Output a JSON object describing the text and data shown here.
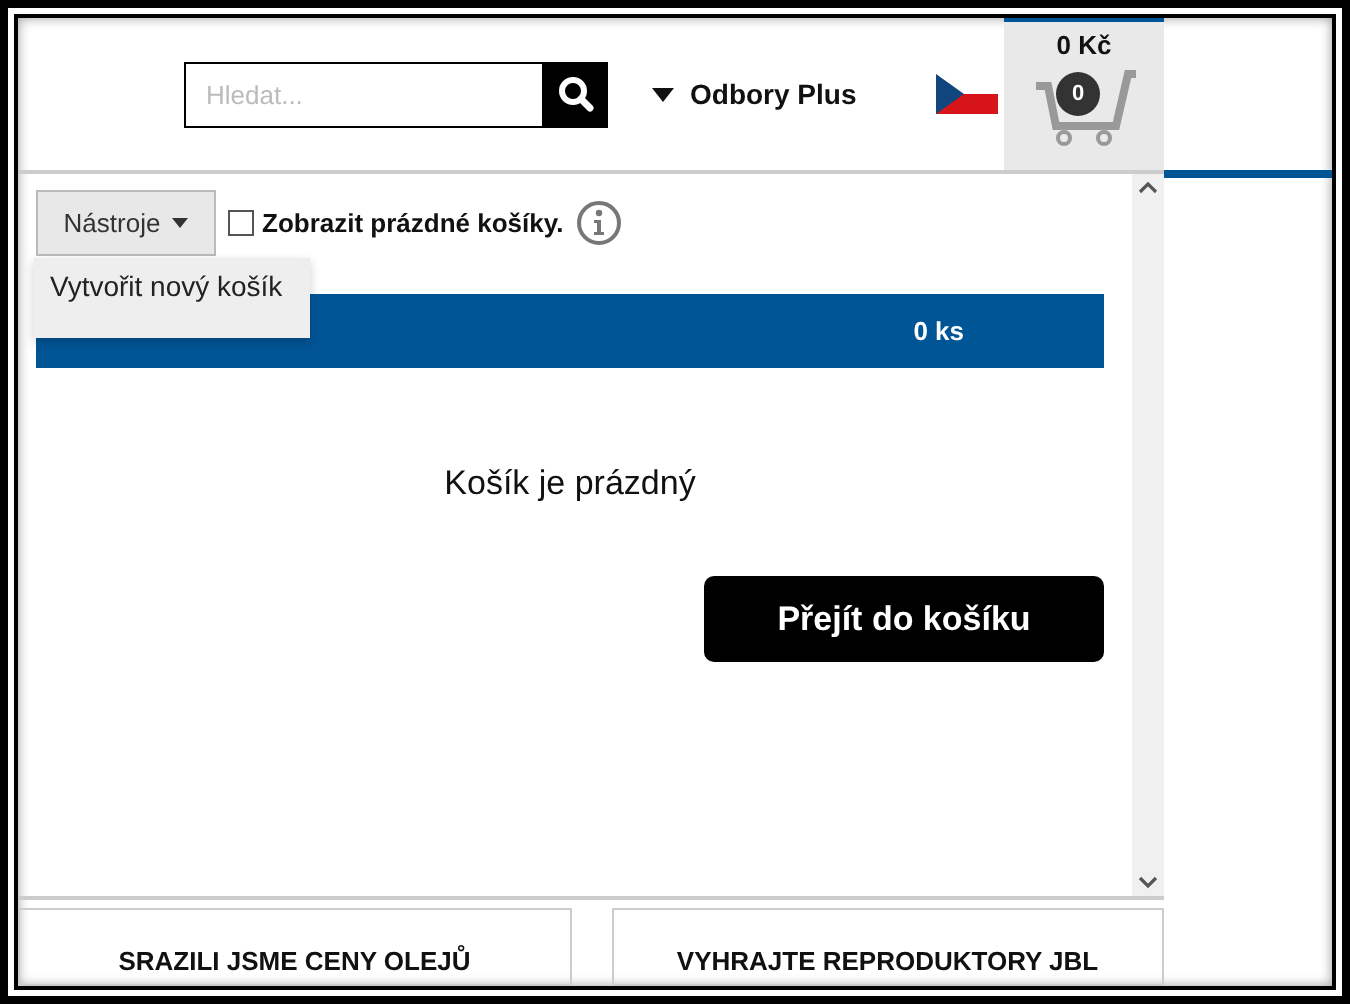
{
  "header": {
    "search": {
      "placeholder": "Hledat..."
    },
    "menu": "Odbory Plus",
    "cart": {
      "total": "0 Kč",
      "count": "0"
    }
  },
  "toolbar": {
    "tools_button": "Nástroje",
    "show_empty": {
      "label": "Zobrazit prázdné košíky.",
      "checked": false
    }
  },
  "dropdown": {
    "items": [
      "Vytvořit nový košík"
    ]
  },
  "basket_bar": {
    "quantity": "0 ks"
  },
  "empty_message": "Košík je prázdný",
  "checkout_button": "Přejít do košíku",
  "promos": [
    "SRAZILI JSME CENY OLEJŮ",
    "VYHRAJTE REPRODUKTORY JBL"
  ]
}
